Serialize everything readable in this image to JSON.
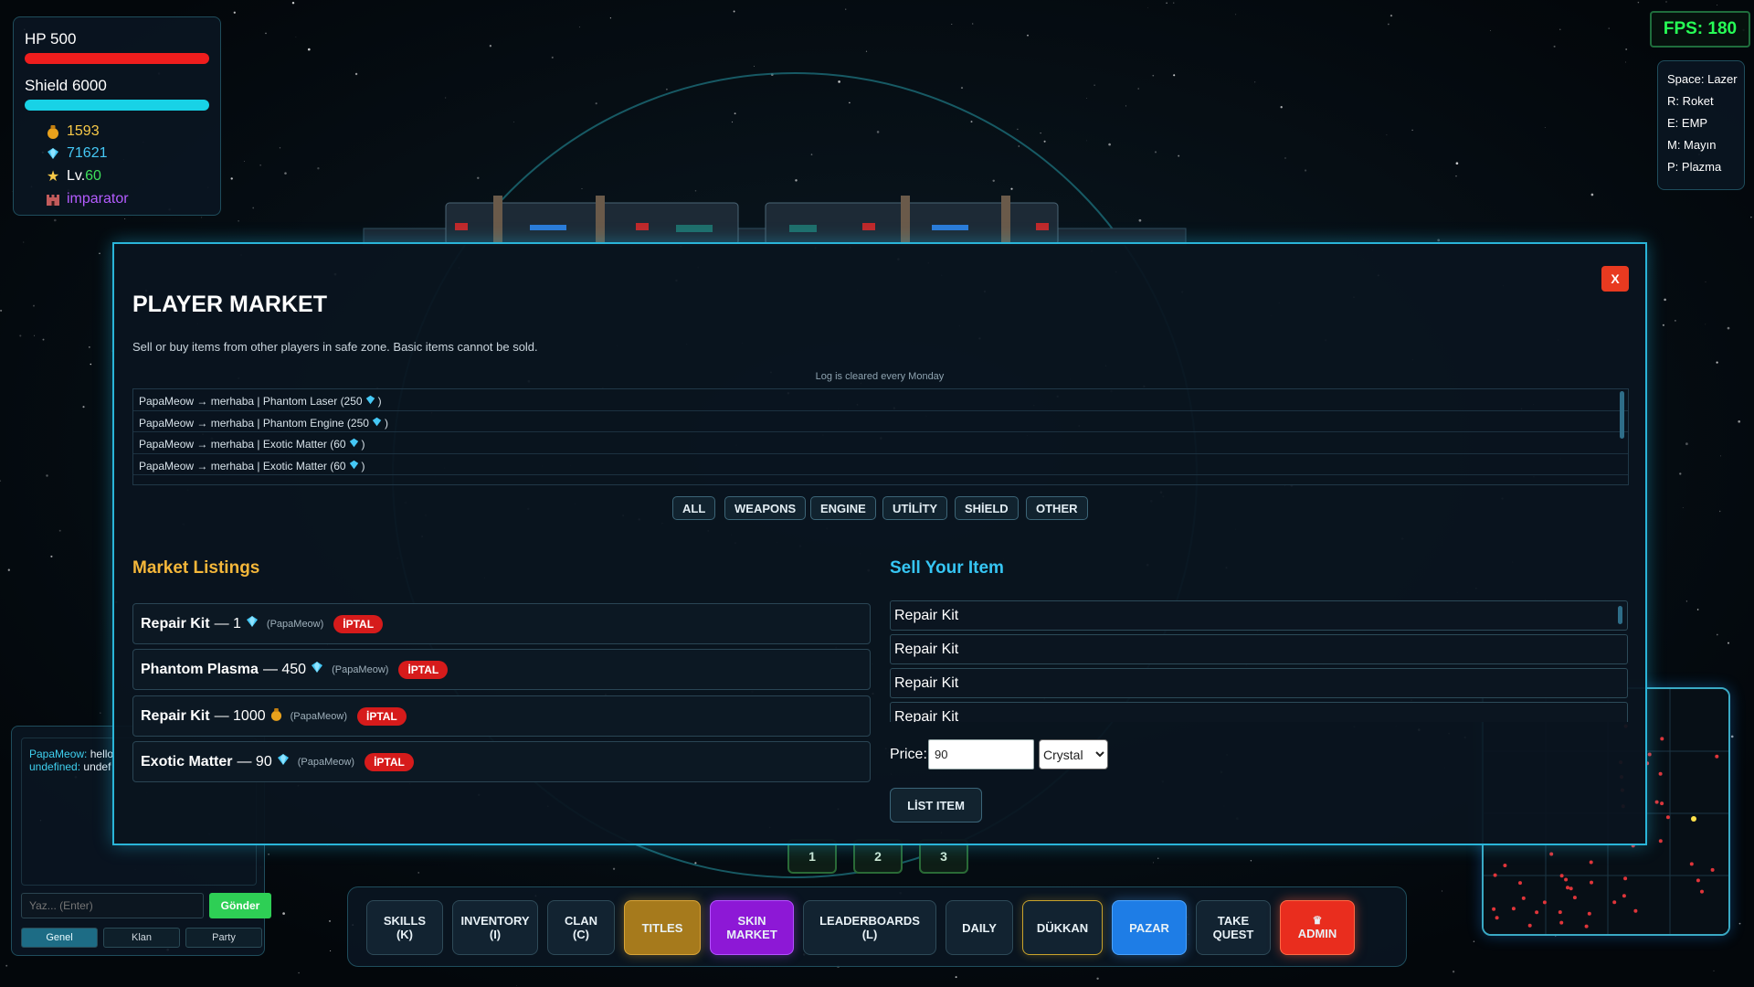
{
  "hud": {
    "hp_label": "HP 500",
    "shield_label": "Shield 6000",
    "gold": "1593",
    "crystal": "71621",
    "level_prefix": "Lv.",
    "level_value": "60",
    "title": "imparator",
    "fps": "FPS: 180",
    "colors": {
      "hp": "#ef1d1d",
      "shield": "#18d2e6",
      "gold": "#f7c948",
      "crystal": "#45c8f5",
      "level": "#3ee05a",
      "title": "#b45cff"
    }
  },
  "keybinds": [
    "Space: Lazer",
    "R: Roket",
    "E: EMP",
    "M: Mayın",
    "P: Plazma"
  ],
  "chat": {
    "messages": [
      {
        "name": "PapaMeow:",
        "text": "hello"
      },
      {
        "name": "undefined:",
        "text": "undef"
      }
    ],
    "input_placeholder": "Yaz... (Enter)",
    "send_label": "Gönder",
    "tabs": [
      "Genel",
      "Klan",
      "Party"
    ]
  },
  "page_tabs": [
    "1",
    "2",
    "3"
  ],
  "actions": {
    "skills": "SKILLS\n(K)",
    "inventory": "INVENTORY\n(I)",
    "clan": "CLAN\n(C)",
    "titles": "TITLES",
    "skin_market": "SKIN\nMARKET",
    "leaderboards": "LEADERBOARDS\n(L)",
    "daily": "DAILY",
    "dukkan": "DÜKKAN",
    "pazar": "PAZAR",
    "take_quest": "TAKE\nQUEST",
    "admin": "ADMIN"
  },
  "market": {
    "close_label": "X",
    "title": "PLAYER MARKET",
    "description": "Sell or buy items from other players in safe zone. Basic items cannot be sold.",
    "log_note": "Log is cleared every Monday",
    "log": [
      {
        "prefix": "PapaMeow → merhaba | Phantom Laser (250",
        "suffix": ")"
      },
      {
        "prefix": "PapaMeow → merhaba | Phantom Engine (250",
        "suffix": ")"
      },
      {
        "prefix": "PapaMeow → merhaba | Exotic Matter (60",
        "suffix": ")"
      },
      {
        "prefix": "PapaMeow → merhaba | Exotic Matter (60",
        "suffix": ")"
      }
    ],
    "filters": {
      "all": "ALL",
      "weapons": "WEAPONS",
      "engine": "ENGINE",
      "utility": "UTİLİTY",
      "shield": "SHİELD",
      "other": "OTHER"
    },
    "listings_heading": "Market Listings",
    "listings": [
      {
        "name": "Repair Kit",
        "price": "— 1",
        "currency": "crystal",
        "seller": "(PapaMeow)",
        "cancel": "İPTAL"
      },
      {
        "name": "Phantom Plasma",
        "price": "— 450",
        "currency": "crystal",
        "seller": "(PapaMeow)",
        "cancel": "İPTAL"
      },
      {
        "name": "Repair Kit",
        "price": "— 1000",
        "currency": "gold",
        "seller": "(PapaMeow)",
        "cancel": "İPTAL"
      },
      {
        "name": "Exotic Matter",
        "price": "— 90",
        "currency": "crystal",
        "seller": "(PapaMeow)",
        "cancel": "İPTAL"
      }
    ],
    "sell_heading": "Sell Your Item",
    "sell_items": [
      "Repair Kit",
      "Repair Kit",
      "Repair Kit",
      "Repair Kit"
    ],
    "price_label": "Price:",
    "price_value": "90",
    "currency_selected": "Crystal",
    "list_button": "LİST ITEM"
  }
}
